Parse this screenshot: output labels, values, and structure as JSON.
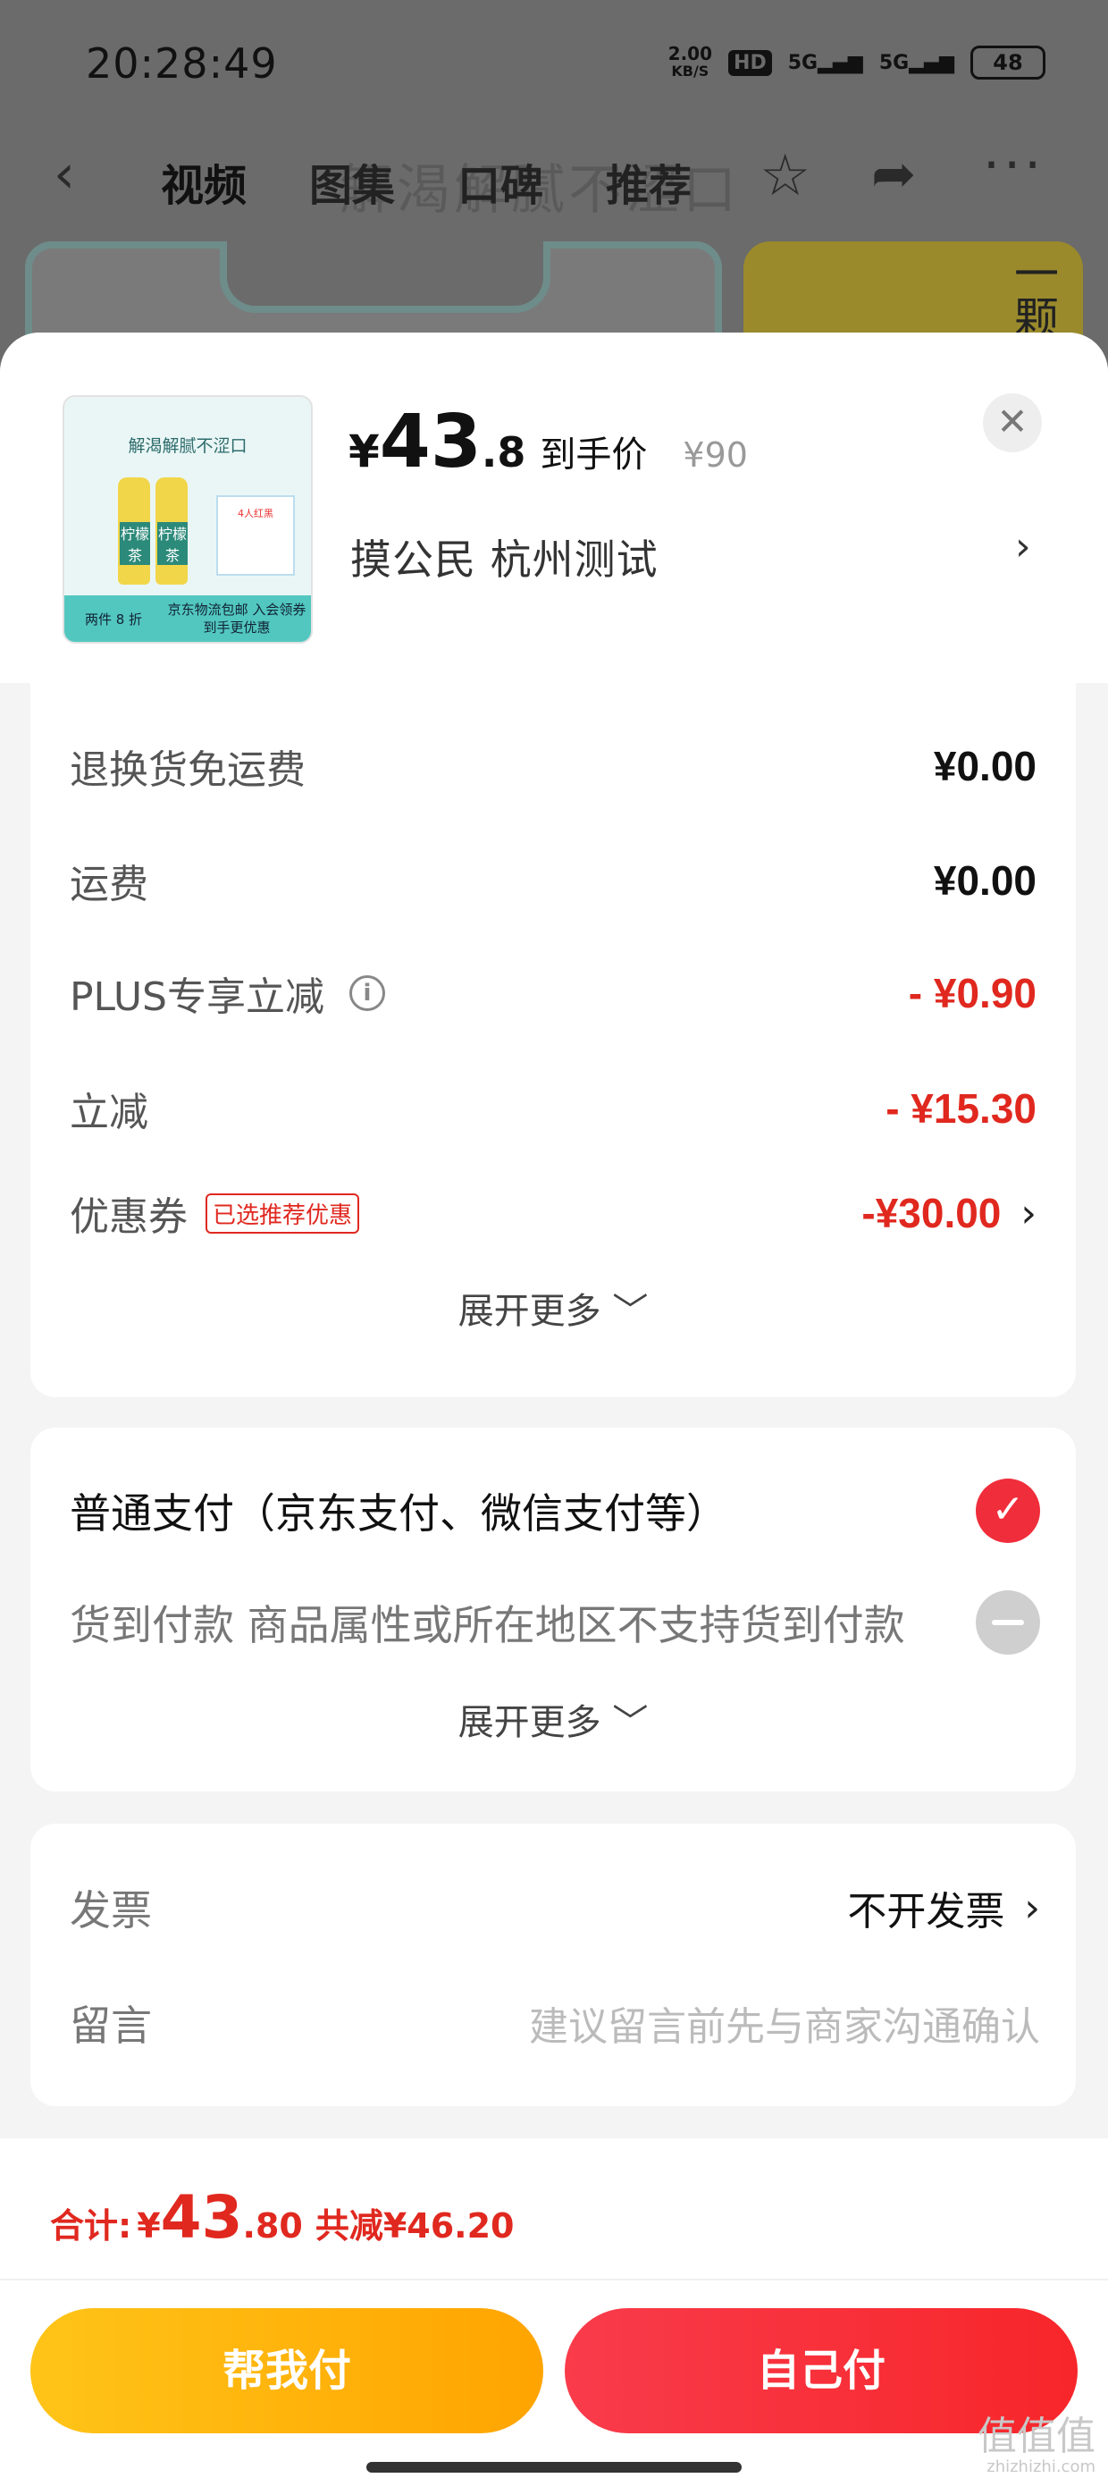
{
  "status_bar": {
    "time": "20:28:49",
    "net_speed_top": "2.00",
    "net_speed_unit": "KB/S",
    "hd": "HD",
    "sig1": "5G",
    "sig2": "5G",
    "battery": "48"
  },
  "nav": {
    "tabs": [
      "视频",
      "图集",
      "口碑",
      "推荐"
    ],
    "ghost_title": "解渴解腻不涩口"
  },
  "background": {
    "card2_text": "一颗"
  },
  "product": {
    "thumb_title": "解渴解腻不涩口",
    "thumb_bottle_label": "柠檬茶",
    "thumb_promo": "两件 8 折",
    "thumb_footer": "京东物流包邮 入会领券到手更优惠",
    "thumb_mini": "4人红黑",
    "price_symbol": "¥",
    "price_int": "43",
    "price_dec": ".8",
    "price_tag": "到手价",
    "price_original": "¥90",
    "address": "摸公民  杭州测试"
  },
  "fees": {
    "items": [
      {
        "label": "退换货免运费",
        "value": "¥0.00"
      },
      {
        "label": "运费",
        "value": "¥0.00"
      },
      {
        "label": "PLUS专享立减",
        "value": "- ¥0.90"
      },
      {
        "label": "立减",
        "value": "- ¥15.30"
      },
      {
        "label": "优惠券",
        "value": "-¥30.00",
        "tag": "已选推荐优惠"
      }
    ],
    "more": "展开更多 ﹀"
  },
  "payment": {
    "normal": "普通支付（京东支付、微信支付等）",
    "cod": "货到付款 商品属性或所在地区不支持货到付款",
    "more": "展开更多 ﹀"
  },
  "extra": {
    "invoice_label": "发票",
    "invoice_value": "不开发票",
    "message_label": "留言",
    "message_placeholder": "建议留言前先与商家沟通确认"
  },
  "footer": {
    "total_label": "合计:",
    "total_symbol": "¥",
    "total_int": "43",
    "total_dec": ".80",
    "total_saving": "共减¥46.20",
    "help_pay": "帮我付",
    "self_pay": "自己付"
  },
  "watermark": {
    "glyphs": "值值值",
    "url": "zhizhizhi.com"
  },
  "colors": {
    "accent_red": "#e0281f",
    "pay_red": "#f7262a",
    "pay_yellow": "#ffa400"
  },
  "icons": [
    "back-icon",
    "star-icon",
    "share-icon",
    "more-icon",
    "close-icon",
    "info-icon",
    "chevron-right-icon",
    "check-icon",
    "disabled-icon"
  ]
}
